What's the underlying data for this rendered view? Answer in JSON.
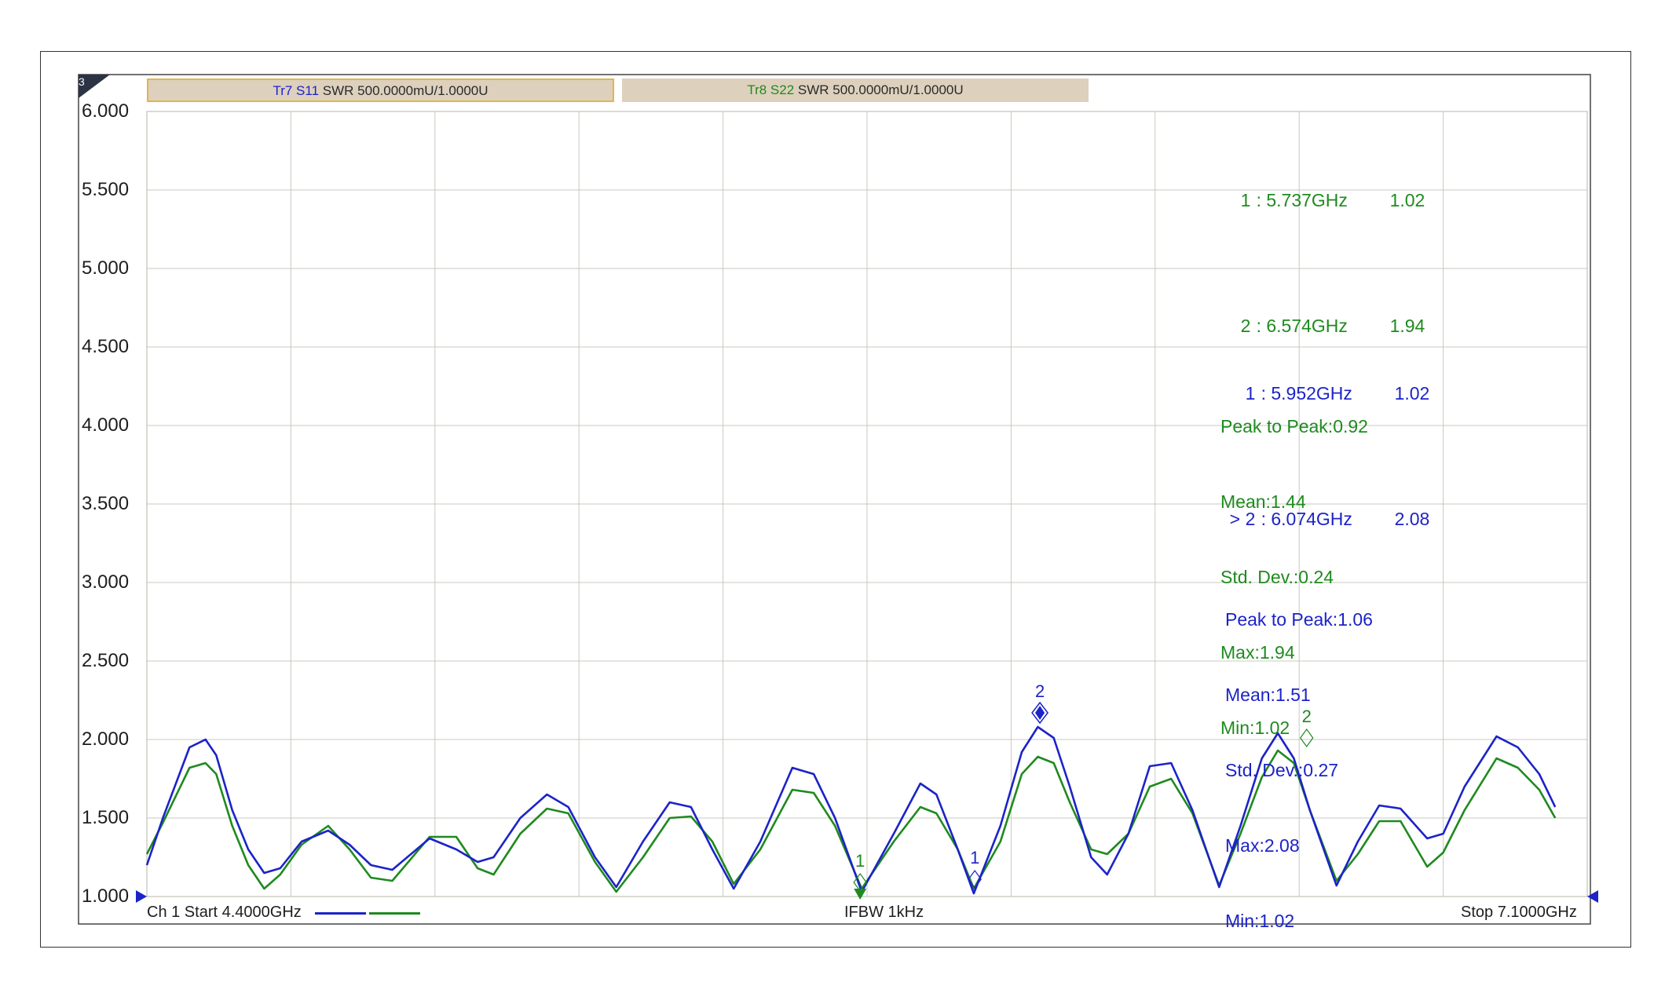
{
  "window": {
    "channel_badge": "3",
    "bottom": {
      "start": "Ch 1 Start 4.4000GHz",
      "ifbw": "IFBW 1kHz",
      "stop": "Stop 7.1000GHz"
    }
  },
  "traces": [
    {
      "id": "Tr7",
      "param": "S11",
      "label": "Tr7 S11",
      "format": "SWR 500.0000mU/1.0000U",
      "color": "#1c23c8",
      "active": true
    },
    {
      "id": "Tr8",
      "param": "S22",
      "label": "Tr8 S22",
      "format": "SWR 500.0000mU/1.0000U",
      "color": "#1f8a1f",
      "active": false
    }
  ],
  "markers": {
    "tr8": {
      "rows": [
        {
          "prefix": "",
          "num": "1",
          "freq": ": 5.737GHz",
          "value": "1.02"
        },
        {
          "prefix": "",
          "num": "2",
          "freq": ": 6.574GHz",
          "value": "1.94"
        }
      ],
      "stats": [
        "Peak to Peak:0.92",
        "Mean:1.44",
        "Std. Dev.:0.24",
        "Max:1.94",
        "Min:1.02"
      ]
    },
    "tr7": {
      "rows": [
        {
          "prefix": "",
          "num": "1",
          "freq": ": 5.952GHz",
          "value": "1.02"
        },
        {
          "prefix": ">",
          "num": "2",
          "freq": ": 6.074GHz",
          "value": "2.08"
        }
      ],
      "stats": [
        "Peak to Peak:1.06",
        "Mean:1.51",
        "Std. Dev.:0.27",
        "Max:2.08",
        "Min:1.02"
      ]
    }
  },
  "chart_data": {
    "type": "line",
    "title": "",
    "xlabel": "",
    "ylabel": "",
    "x_unit": "GHz",
    "xlim": [
      4.4,
      7.1
    ],
    "ylim": [
      1.0,
      6.0
    ],
    "y_ticks": [
      "6.000",
      "5.500",
      "5.000",
      "4.500",
      "4.000",
      "3.500",
      "3.000",
      "2.500",
      "2.000",
      "1.500",
      "1.000"
    ],
    "x_divisions": 10,
    "grid": true,
    "series": [
      {
        "name": "Tr7 S11",
        "color": "#1c23c8",
        "points": [
          [
            4.4,
            1.2
          ],
          [
            4.43,
            1.5
          ],
          [
            4.48,
            1.95
          ],
          [
            4.51,
            2.0
          ],
          [
            4.53,
            1.9
          ],
          [
            4.56,
            1.55
          ],
          [
            4.59,
            1.3
          ],
          [
            4.62,
            1.15
          ],
          [
            4.65,
            1.18
          ],
          [
            4.69,
            1.35
          ],
          [
            4.74,
            1.42
          ],
          [
            4.78,
            1.33
          ],
          [
            4.82,
            1.2
          ],
          [
            4.86,
            1.17
          ],
          [
            4.93,
            1.37
          ],
          [
            4.98,
            1.3
          ],
          [
            5.02,
            1.22
          ],
          [
            5.05,
            1.25
          ],
          [
            5.1,
            1.5
          ],
          [
            5.15,
            1.65
          ],
          [
            5.19,
            1.57
          ],
          [
            5.24,
            1.25
          ],
          [
            5.28,
            1.06
          ],
          [
            5.33,
            1.35
          ],
          [
            5.38,
            1.6
          ],
          [
            5.42,
            1.57
          ],
          [
            5.46,
            1.3
          ],
          [
            5.5,
            1.05
          ],
          [
            5.55,
            1.35
          ],
          [
            5.61,
            1.82
          ],
          [
            5.65,
            1.78
          ],
          [
            5.69,
            1.5
          ],
          [
            5.74,
            1.03
          ],
          [
            5.8,
            1.4
          ],
          [
            5.85,
            1.72
          ],
          [
            5.88,
            1.65
          ],
          [
            5.92,
            1.3
          ],
          [
            5.95,
            1.02
          ],
          [
            6.0,
            1.45
          ],
          [
            6.04,
            1.92
          ],
          [
            6.07,
            2.08
          ],
          [
            6.1,
            2.01
          ],
          [
            6.13,
            1.7
          ],
          [
            6.17,
            1.25
          ],
          [
            6.2,
            1.14
          ],
          [
            6.24,
            1.4
          ],
          [
            6.28,
            1.83
          ],
          [
            6.32,
            1.85
          ],
          [
            6.36,
            1.55
          ],
          [
            6.41,
            1.06
          ],
          [
            6.45,
            1.45
          ],
          [
            6.49,
            1.88
          ],
          [
            6.52,
            2.04
          ],
          [
            6.55,
            1.88
          ],
          [
            6.58,
            1.55
          ],
          [
            6.63,
            1.07
          ],
          [
            6.67,
            1.35
          ],
          [
            6.71,
            1.58
          ],
          [
            6.75,
            1.56
          ],
          [
            6.8,
            1.37
          ],
          [
            6.83,
            1.4
          ],
          [
            6.87,
            1.7
          ],
          [
            6.93,
            2.02
          ],
          [
            6.97,
            1.95
          ],
          [
            7.01,
            1.78
          ],
          [
            7.04,
            1.57
          ]
        ]
      },
      {
        "name": "Tr8 S22",
        "color": "#1f8a1f",
        "points": [
          [
            4.4,
            1.27
          ],
          [
            4.43,
            1.47
          ],
          [
            4.48,
            1.82
          ],
          [
            4.51,
            1.85
          ],
          [
            4.53,
            1.78
          ],
          [
            4.56,
            1.45
          ],
          [
            4.59,
            1.2
          ],
          [
            4.62,
            1.05
          ],
          [
            4.65,
            1.14
          ],
          [
            4.69,
            1.33
          ],
          [
            4.74,
            1.45
          ],
          [
            4.78,
            1.3
          ],
          [
            4.82,
            1.12
          ],
          [
            4.86,
            1.1
          ],
          [
            4.93,
            1.38
          ],
          [
            4.98,
            1.38
          ],
          [
            5.02,
            1.18
          ],
          [
            5.05,
            1.14
          ],
          [
            5.1,
            1.4
          ],
          [
            5.15,
            1.56
          ],
          [
            5.19,
            1.53
          ],
          [
            5.24,
            1.22
          ],
          [
            5.28,
            1.03
          ],
          [
            5.33,
            1.25
          ],
          [
            5.38,
            1.5
          ],
          [
            5.42,
            1.51
          ],
          [
            5.46,
            1.35
          ],
          [
            5.5,
            1.08
          ],
          [
            5.55,
            1.3
          ],
          [
            5.61,
            1.68
          ],
          [
            5.65,
            1.66
          ],
          [
            5.69,
            1.45
          ],
          [
            5.74,
            1.05
          ],
          [
            5.8,
            1.35
          ],
          [
            5.85,
            1.57
          ],
          [
            5.88,
            1.53
          ],
          [
            5.92,
            1.3
          ],
          [
            5.95,
            1.05
          ],
          [
            6.0,
            1.35
          ],
          [
            6.04,
            1.78
          ],
          [
            6.07,
            1.89
          ],
          [
            6.1,
            1.85
          ],
          [
            6.13,
            1.6
          ],
          [
            6.17,
            1.3
          ],
          [
            6.2,
            1.27
          ],
          [
            6.24,
            1.4
          ],
          [
            6.28,
            1.7
          ],
          [
            6.32,
            1.75
          ],
          [
            6.36,
            1.53
          ],
          [
            6.41,
            1.07
          ],
          [
            6.45,
            1.4
          ],
          [
            6.49,
            1.76
          ],
          [
            6.52,
            1.93
          ],
          [
            6.55,
            1.85
          ],
          [
            6.58,
            1.55
          ],
          [
            6.63,
            1.1
          ],
          [
            6.67,
            1.27
          ],
          [
            6.71,
            1.48
          ],
          [
            6.75,
            1.48
          ],
          [
            6.8,
            1.19
          ],
          [
            6.83,
            1.28
          ],
          [
            6.87,
            1.55
          ],
          [
            6.93,
            1.88
          ],
          [
            6.97,
            1.82
          ],
          [
            7.01,
            1.68
          ],
          [
            7.04,
            1.5
          ]
        ]
      }
    ],
    "markers": [
      {
        "trace": "Tr8 S22",
        "label": "1",
        "x": 5.737,
        "y": 1.02,
        "color": "#1f8a1f"
      },
      {
        "trace": "Tr8 S22",
        "label": "2",
        "x": 6.574,
        "y": 1.94,
        "color": "#1f8a1f"
      },
      {
        "trace": "Tr7 S11",
        "label": "1",
        "x": 5.952,
        "y": 1.02,
        "color": "#1c23c8"
      },
      {
        "trace": "Tr7 S11",
        "label": "2",
        "x": 6.074,
        "y": 2.08,
        "color": "#1c23c8",
        "active": true
      }
    ]
  }
}
